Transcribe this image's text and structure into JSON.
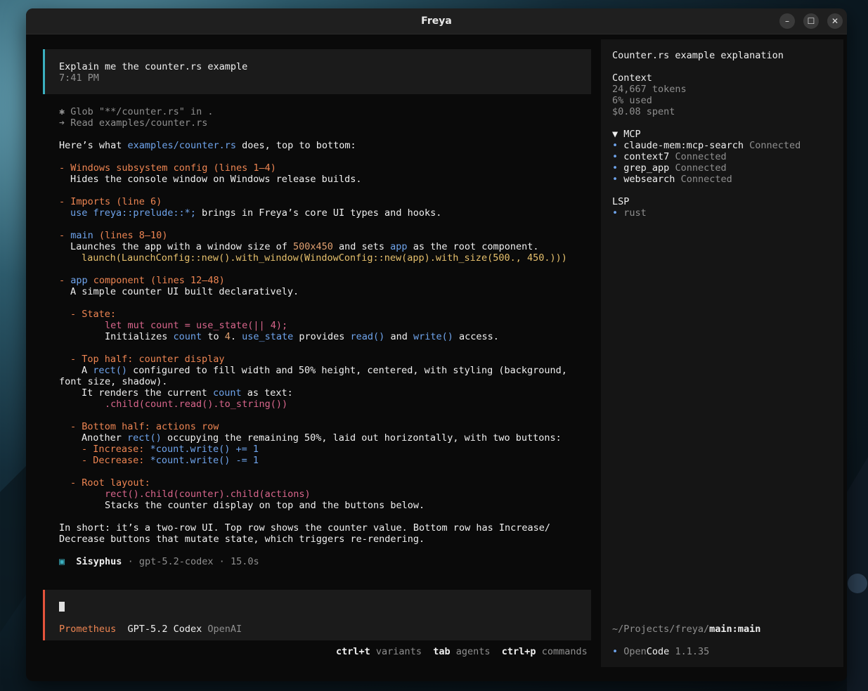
{
  "window": {
    "title": "Freya",
    "minimize": "–",
    "maximize": "☐",
    "close": "✕"
  },
  "user_message": {
    "text": "Explain me the counter.rs example",
    "time": "7:41 PM"
  },
  "tools": [
    {
      "icon": "✱",
      "text": "Glob \"**/counter.rs\" in ."
    },
    {
      "icon": "➔",
      "text": "Read examples/counter.rs"
    }
  ],
  "response": {
    "intro_a": "Here’s what ",
    "intro_file": "examples/counter.rs",
    "intro_b": " does, top to bottom:",
    "sec1_title": "Windows subsystem config (lines 1–4)",
    "sec1_body": "Hides the console window on Windows release builds.",
    "sec2_title": "Imports (line 6)",
    "sec2_use": "use",
    "sec2_path": "freya::prelude::*;",
    "sec2_rest": " brings in Freya’s core UI types and hooks.",
    "sec3_kw": "main",
    "sec3_title": " (lines 8–10)",
    "sec3_a": "Launches the app with a window size of ",
    "sec3_size": "500x450",
    "sec3_b": " and sets ",
    "sec3_app": "app",
    "sec3_c": " as the root component.",
    "sec3_code": "launch(LaunchConfig::new().with_window(WindowConfig::new(app).with_size(500., 450.)))",
    "sec4_kw": "app",
    "sec4_title": " component (lines 12–48)",
    "sec4_body": "A simple counter UI built declaratively.",
    "state_title": "State:",
    "state_code": "let mut count = use_state(|| 4);",
    "state_a": "Initializes ",
    "state_count": "count",
    "state_b": " to ",
    "state_four": "4",
    "state_c": ". ",
    "state_usestate": "use_state",
    "state_d": " provides ",
    "state_read": "read()",
    "state_e": " and ",
    "state_write": "write()",
    "state_f": " access.",
    "top_title": "Top half: counter display",
    "top_a": "A ",
    "top_rect": "rect()",
    "top_b": " configured to fill width and 50% height, centered, with styling (background,",
    "top_c": "font size, shadow).",
    "top_d": "It renders the current ",
    "top_count": "count",
    "top_e": " as text:",
    "top_code": ".child(count.read().to_string())",
    "bottom_title": "Bottom half: actions row",
    "bottom_a": "Another ",
    "bottom_rect": "rect()",
    "bottom_b": " occupying the remaining 50%, laid out horizontally, with two buttons:",
    "inc_label": "Increase:",
    "inc_code": "*count.write() += 1",
    "dec_label": "Decrease:",
    "dec_code": "*count.write() -= 1",
    "root_title": "Root layout:",
    "root_code": "rect().child(counter).child(actions)",
    "root_body": "Stacks the counter display on top and the buttons below.",
    "short_1": "In short: it’s a two-row UI. Top row shows the counter value. Bottom row has Increase/",
    "short_2": "Decrease buttons that mutate state, which triggers re-rendering."
  },
  "footer_agent": {
    "icon": "▣",
    "name": "Sisyphus",
    "sep": "·",
    "model": "gpt-5.2-codex",
    "time": "15.0s"
  },
  "input": {
    "agent": "Prometheus",
    "model": "GPT-5.2 Codex",
    "provider": "OpenAI"
  },
  "shortcuts": [
    {
      "key": "ctrl+t",
      "label": "variants"
    },
    {
      "key": "tab",
      "label": "agents"
    },
    {
      "key": "ctrl+p",
      "label": "commands"
    }
  ],
  "sidebar": {
    "title": "Counter.rs example explanation",
    "context_label": "Context",
    "tokens": "24,667 tokens",
    "used": "6% used",
    "spent": "$0.08 spent",
    "mcp_label": "▼ MCP",
    "mcp": [
      {
        "name": "claude-mem:mcp-search",
        "status": "Connected"
      },
      {
        "name": "context7",
        "status": "Connected"
      },
      {
        "name": "grep_app",
        "status": "Connected"
      },
      {
        "name": "websearch",
        "status": "Connected"
      }
    ],
    "lsp_label": "LSP",
    "lsp": [
      "rust"
    ],
    "path_prefix": "~/Projects/freya/",
    "path_branch": "main:main",
    "app_open": "Open",
    "app_code": "Code",
    "app_version": "1.1.35"
  }
}
